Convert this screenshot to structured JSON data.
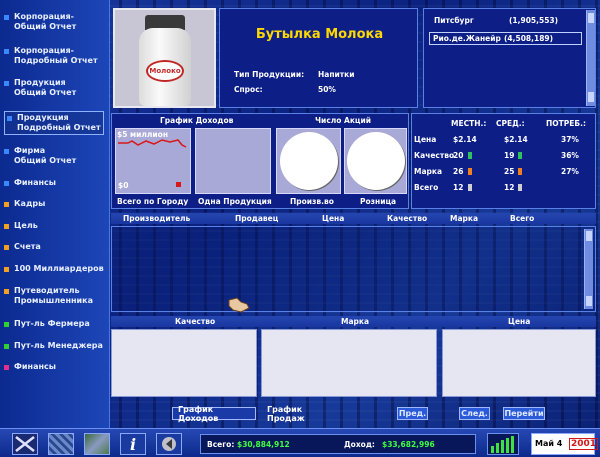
{
  "sidebar": {
    "items": [
      {
        "label": "Корпорация-\nОбщий Отчет",
        "color": "#3a88ff",
        "selected": false
      },
      {
        "label": "Корпорация-\nПодробный Отчет",
        "color": "#3a88ff",
        "selected": false
      },
      {
        "label": "Продукция\nОбщий Отчет",
        "color": "#3a88ff",
        "selected": false
      },
      {
        "label": "Продукция\nПодробный Отчет",
        "color": "#3a88ff",
        "selected": true
      },
      {
        "label": "Фирма\nОбщий Отчет",
        "color": "#3a88ff",
        "selected": false
      },
      {
        "label": "Финансы",
        "color": "#3a88ff",
        "selected": false
      },
      {
        "label": "Кадры",
        "color": "#f0a020",
        "selected": false
      },
      {
        "label": "Цель",
        "color": "#f0a020",
        "selected": false
      },
      {
        "label": "Счета",
        "color": "#f0a020",
        "selected": false
      },
      {
        "label": "100 Миллиардеров",
        "color": "#f0a020",
        "selected": false
      },
      {
        "label": "Путеводитель\nПромышленника",
        "color": "#f0a020",
        "selected": false
      },
      {
        "label": "Пут-ль Фермера",
        "color": "#30d030",
        "selected": false
      },
      {
        "label": "Пут-ль Менеджера",
        "color": "#30d030",
        "selected": false
      },
      {
        "label": "Финансы",
        "color": "#e0308a",
        "selected": false
      }
    ]
  },
  "product": {
    "name": "Бутылка Молока",
    "bottle_label": "Молоко",
    "type_label": "Тип Продукции:",
    "type_value": "Напитки",
    "demand_label": "Спрос:",
    "demand_value": "50%"
  },
  "cities": [
    {
      "name": "Питсбург",
      "population": "(1,905,553)",
      "selected": false
    },
    {
      "name": "Рио.де.Жанейр",
      "population": "(4,508,189)",
      "selected": true
    }
  ],
  "charts": {
    "income_title": "График Доходов",
    "shares_title": "Число Акций",
    "income_top": "$5 миллион",
    "income_bottom": "$0",
    "income_city_label": "Всего по Городу",
    "income_product_label": "Одна Продукция",
    "shares_production_label": "Произв.во",
    "shares_retail_label": "Розница"
  },
  "stats": {
    "headers": {
      "local": "МЕСТН.:",
      "avg": "СРЕД.:",
      "consumer": "ПОТРЕБ.:"
    },
    "rows": [
      {
        "label": "Цена",
        "local": "$2.14",
        "avg": "$2.14",
        "consumer": "37%"
      },
      {
        "label": "Качество",
        "local": "20",
        "local_color": "#30c060",
        "avg": "19",
        "avg_color": "#30c060",
        "consumer": "36%"
      },
      {
        "label": "Марка",
        "local": "26",
        "local_color": "#f08020",
        "avg": "25",
        "avg_color": "#f08020",
        "consumer": "27%"
      },
      {
        "label": "Всего",
        "local": "12",
        "local_color": "#d0d0d0",
        "avg": "12",
        "avg_color": "#d0d0d0",
        "consumer": ""
      }
    ]
  },
  "sellers_table": {
    "headers": [
      "Производитель",
      "Продавец",
      "Цена",
      "Качество",
      "Марка",
      "Всего"
    ]
  },
  "compare_table": {
    "headers": [
      "Качество",
      "Марка",
      "Цена"
    ]
  },
  "bottom_buttons": {
    "income_chart": "График Доходов",
    "sales_chart": "График Продаж",
    "prev": "Пред.",
    "next": "След.",
    "go": "Перейти"
  },
  "taskbar": {
    "total_label": "Всего:",
    "total_value": "$30,884,912",
    "income_label": "Доход:",
    "income_value": "$33,682,996",
    "date_month": "Май 4",
    "date_year": "2001",
    "info_icon_glyph": "i"
  }
}
